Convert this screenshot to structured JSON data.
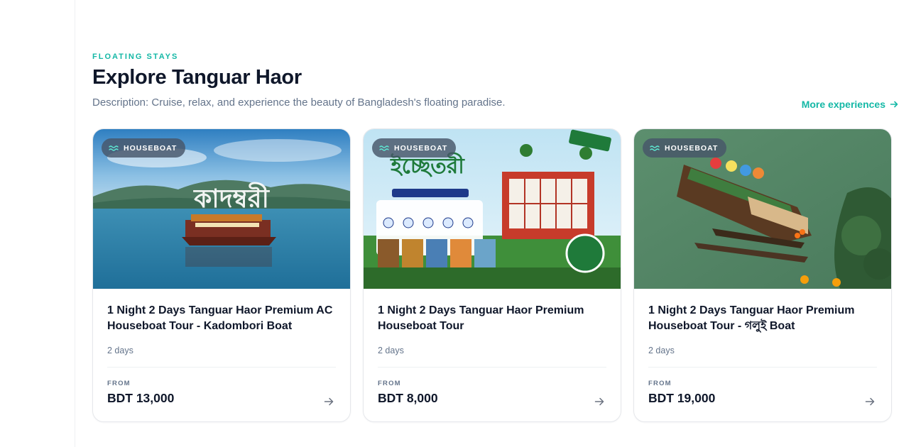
{
  "section": {
    "eyebrow": "FLOATING STAYS",
    "title": "Explore Tanguar Haor",
    "description": "Description: Cruise, relax, and experience the beauty of Bangladesh's floating paradise.",
    "more_link": "More experiences"
  },
  "cards": [
    {
      "badge": "HOUSEBOAT",
      "title": "1 Night 2 Days Tanguar Haor Premium AC Houseboat Tour - Kadombori Boat",
      "duration": "2 days",
      "from_label": "FROM",
      "price": "BDT 13,000",
      "image_text": "কাদম্বরী"
    },
    {
      "badge": "HOUSEBOAT",
      "title": "1 Night 2 Days Tanguar Haor Premium Houseboat Tour",
      "duration": "2 days",
      "from_label": "FROM",
      "price": "BDT 8,000",
      "image_text": "ইচ্ছেতরী"
    },
    {
      "badge": "HOUSEBOAT",
      "title": "1 Night 2 Days Tanguar Haor Premium Houseboat Tour - গলুই Boat",
      "duration": "2 days",
      "from_label": "FROM",
      "price": "BDT 19,000"
    }
  ],
  "icons": {
    "more_link": "arrow-right-icon",
    "badge": "waves-icon",
    "card_action": "arrow-right-icon"
  },
  "colors": {
    "accent": "#14b8a6",
    "title": "#0f172a",
    "muted": "#64748b",
    "badge_bg": "#475569"
  }
}
